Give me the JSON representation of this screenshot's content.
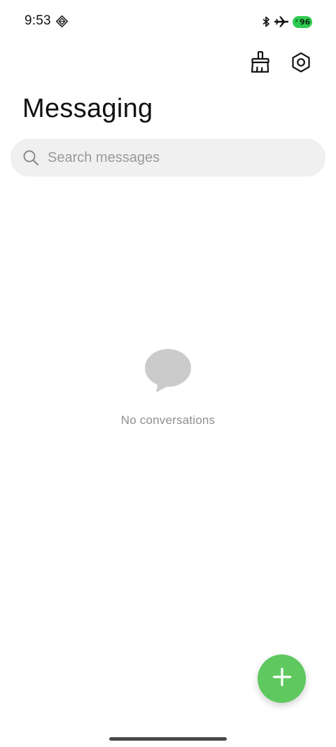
{
  "status_bar": {
    "time": "9:53",
    "battery_level": "96",
    "icons": [
      "nfc-icon",
      "bluetooth-icon",
      "airplane-mode-icon",
      "battery-icon"
    ],
    "battery_color": "#2ecc52"
  },
  "toolbar": {
    "icons": [
      "broom-icon",
      "settings-icon"
    ]
  },
  "header": {
    "title": "Messaging"
  },
  "search": {
    "placeholder": "Search messages",
    "icon": "search-icon"
  },
  "empty_state": {
    "icon": "chat-bubble-icon",
    "text": "No conversations"
  },
  "fab": {
    "icon": "plus-icon",
    "color": "#5fc95f"
  }
}
